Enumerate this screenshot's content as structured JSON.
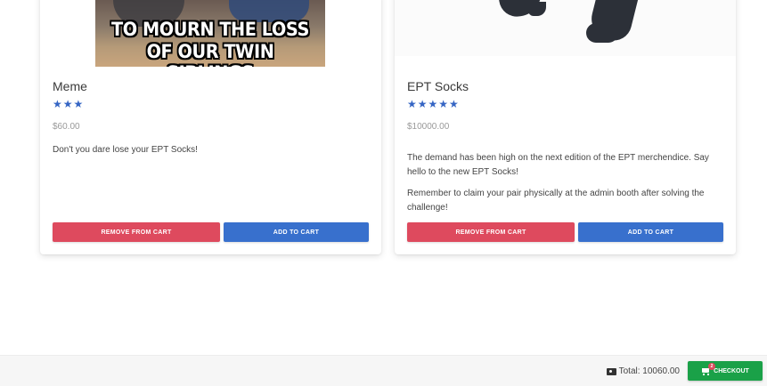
{
  "products": [
    {
      "image_text": [
        "TO MOURN THE LOSS",
        "OF OUR TWIN SIBLINGS"
      ],
      "title": "Meme",
      "rating": 3,
      "stars": "★★★",
      "price": "$60.00",
      "description": [
        "Don't you dare lose your EPT Socks!"
      ],
      "remove_label": "Remove from cart",
      "add_label": "Add to cart"
    },
    {
      "title": "EPT Socks",
      "rating": 5,
      "stars": "★★★★★",
      "price": "$10000.00",
      "description": [
        "The demand has been high on the next edition of the EPT merchendice. Say hello to the new EPT Socks!",
        "Remember to claim your pair physically at the admin booth after solving the challenge!"
      ],
      "remove_label": "Remove from cart",
      "add_label": "Add to cart"
    }
  ],
  "footer": {
    "total_label": "Total: 10060.00",
    "total_icon": "money-bill-icon",
    "checkout_label": "Checkout",
    "checkout_icon": "shopping-cart-icon",
    "cart_count": "2"
  },
  "colors": {
    "remove": "#de4a5e",
    "add": "#3870cd",
    "checkout": "#1aa148",
    "star": "#3565c4"
  }
}
